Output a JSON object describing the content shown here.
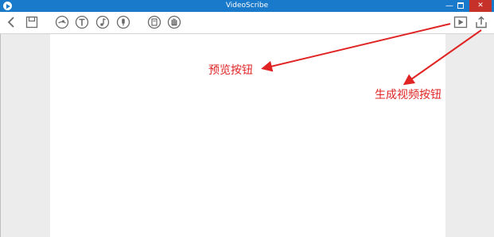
{
  "window": {
    "title": "VideoScribe",
    "minimize": "—",
    "close": "✕"
  },
  "toolbar": {
    "items": [
      {
        "icon": "back-icon"
      },
      {
        "icon": "save-icon"
      },
      {
        "icon": "image-icon"
      },
      {
        "icon": "text-icon"
      },
      {
        "icon": "music-icon"
      },
      {
        "icon": "voiceover-icon"
      },
      {
        "icon": "background-icon"
      },
      {
        "icon": "hand-icon"
      },
      {
        "icon": "preview-icon"
      },
      {
        "icon": "share-icon"
      }
    ]
  },
  "annotations": {
    "preview": "预览按钮",
    "generate": "生成视频按钮"
  },
  "colors": {
    "titlebar": "#1979ca",
    "close_button": "#c6322a",
    "annotation": "#e02424",
    "icon": "#6a6a6a",
    "workarea": "#ececec"
  }
}
